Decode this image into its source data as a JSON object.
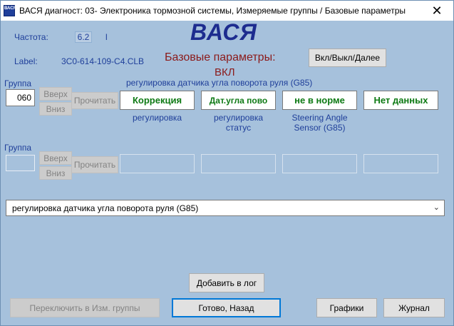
{
  "window": {
    "title": "ВАСЯ диагност: 03- Электроника тормозной системы,  Измеряемые группы / Базовые параметры",
    "icon_text": "ВАСЯ",
    "close_glyph": "✕"
  },
  "header": {
    "frequency_label": "Частота:",
    "frequency_value": "6.2",
    "frequency_unit": "l",
    "label_label": "Label:",
    "label_value": "3C0-614-109-C4.CLB",
    "brand": "ВАСЯ",
    "basic_settings_title": "Базовые параметры:",
    "basic_settings_state": "ВКЛ",
    "toggle_button": "Вкл/Выкл/Далее"
  },
  "group1": {
    "label": "Группа",
    "value": "060",
    "up_button": "Вверх",
    "down_button": "Вниз",
    "read_button": "Прочитать",
    "description": "регулировка датчика угла поворота руля (G85)",
    "fields": [
      {
        "value": "Коррекция",
        "caption": "регулировка"
      },
      {
        "value": "Дат.угла пово",
        "caption": "регулировка\nстатус"
      },
      {
        "value": "не в норме",
        "caption": "Steering Angle\nSensor (G85)"
      },
      {
        "value": "Нет данных",
        "caption": ""
      }
    ]
  },
  "group2": {
    "label": "Группа",
    "value": "",
    "up_button": "Вверх",
    "down_button": "Вниз",
    "read_button": "Прочитать"
  },
  "dropdown": {
    "selected": "регулировка датчика угла поворота руля (G85)",
    "chevron": "⌄"
  },
  "footer": {
    "add_log": "Добавить в лог",
    "switch_groups": "Переключить в Изм. группы",
    "done_back": "Готово, Назад",
    "graphs": "Графики",
    "journal": "Журнал"
  }
}
